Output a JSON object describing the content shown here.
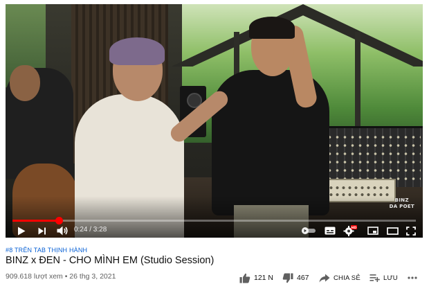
{
  "player": {
    "watermark_line1": "BINZ",
    "watermark_line2": "DA POET",
    "progress": {
      "current": "0:24",
      "duration": "3:28",
      "fraction": 0.115
    },
    "time_display": "0:24 / 3:28",
    "controls": {
      "play": "play-icon",
      "next": "next-icon",
      "volume": "volume-icon",
      "autoplay": "autoplay-toggle-icon",
      "captions": "captions-icon",
      "settings": "settings-gear-icon",
      "settings_badge": "HD",
      "miniplayer": "miniplayer-icon",
      "theater": "theater-mode-icon",
      "fullscreen": "fullscreen-icon"
    }
  },
  "video": {
    "trending_tag": "#8 TRÊN TAB THỊNH HÀNH",
    "title": "BINZ x ĐEN - CHO MÌNH EM (Studio Session)",
    "views_date": "909.618 lượt xem • 26 thg 3, 2021"
  },
  "actions": {
    "like_count": "121 N",
    "dislike_count": "467",
    "share_label": "CHIA SẺ",
    "save_label": "LƯU",
    "more": "more-icon"
  },
  "colors": {
    "accent_red": "#ff0000",
    "link_blue": "#065fd4",
    "meta_gray": "#606060"
  }
}
